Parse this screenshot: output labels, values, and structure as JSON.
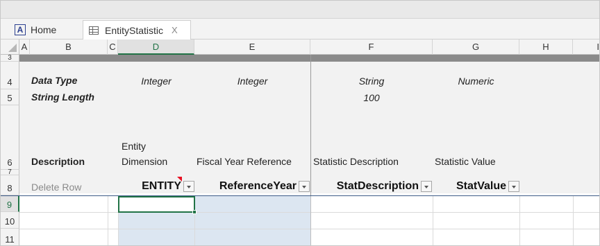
{
  "tabs": {
    "home_label": "Home",
    "home_icon": "a-icon",
    "active_label": "EntityStatistic",
    "active_icon": "table-icon",
    "close_glyph": "X"
  },
  "columns": [
    "A",
    "B",
    "C",
    "D",
    "E",
    "F",
    "G",
    "H",
    "I"
  ],
  "rows": {
    "r3": "3",
    "r4": "4",
    "r5": "5",
    "r6": "6",
    "r7": "7",
    "r8": "8",
    "r9": "9",
    "r10": "10",
    "r11": "11"
  },
  "meta": {
    "data_type_label": "Data Type",
    "string_length_label": "String Length",
    "description_label": "Description",
    "delete_row_label": "Delete Row",
    "types": {
      "D": "Integer",
      "E": "Integer",
      "F": "String",
      "G": "Numeric"
    },
    "lengths": {
      "F": "100"
    },
    "descriptions": {
      "D_line1": "Entity",
      "D_line2": "Dimension",
      "E": "Fiscal Year Reference",
      "F": "Statistic Description",
      "G": "Statistic Value"
    }
  },
  "headers": {
    "D": "ENTITY",
    "E": "ReferenceYear",
    "F": "StatDescription",
    "G": "StatValue"
  },
  "colors": {
    "selection_green": "#217346",
    "input_blue": "#dce6f1",
    "comment_red": "#e81123"
  }
}
